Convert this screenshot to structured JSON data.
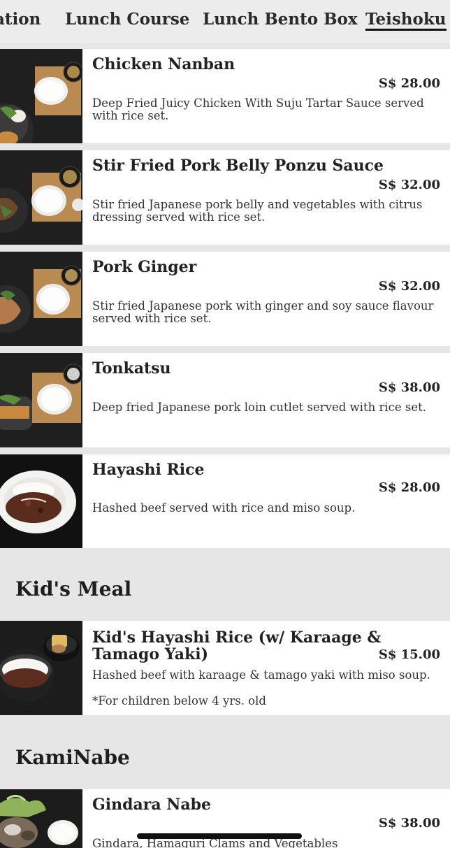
{
  "tabs": [
    {
      "label": "ation"
    },
    {
      "label": "Lunch Course"
    },
    {
      "label": "Lunch Bento Box"
    },
    {
      "label": "Teishoku"
    }
  ],
  "teishoku_items": [
    {
      "name": "Chicken Nanban",
      "price": "S$ 28.00",
      "description": "Deep Fried Juicy Chicken With Suju Tartar Sauce served with rice set."
    },
    {
      "name": "Stir Fried Pork Belly Ponzu Sauce",
      "price": "S$ 32.00",
      "description": "Stir fried Japanese pork belly and vegetables with citrus dressing served with rice set."
    },
    {
      "name": "Pork Ginger",
      "price": "S$ 32.00",
      "description": "Stir fried Japanese pork with ginger and soy sauce flavour served with rice set."
    },
    {
      "name": "Tonkatsu",
      "price": "S$ 38.00",
      "description": "Deep fried Japanese pork loin cutlet served with rice set."
    },
    {
      "name": "Hayashi Rice",
      "price": "S$ 28.00",
      "description": "Hashed beef served with rice and miso soup."
    }
  ],
  "kids_section": {
    "title": "Kid's Meal",
    "item": {
      "name": "Kid's Hayashi Rice (w/ Karaage & Tamago Yaki)",
      "price": "S$ 15.00",
      "description": "Hashed beef with karaage & tamago yaki with miso soup.",
      "note": "*For children below 4 yrs. old"
    }
  },
  "kaminabe_section": {
    "title": "KamiNabe",
    "item": {
      "name": "Gindara Nabe",
      "price": "S$ 38.00",
      "description": "Gindara, Hamaguri Clams and Vegetables"
    }
  }
}
